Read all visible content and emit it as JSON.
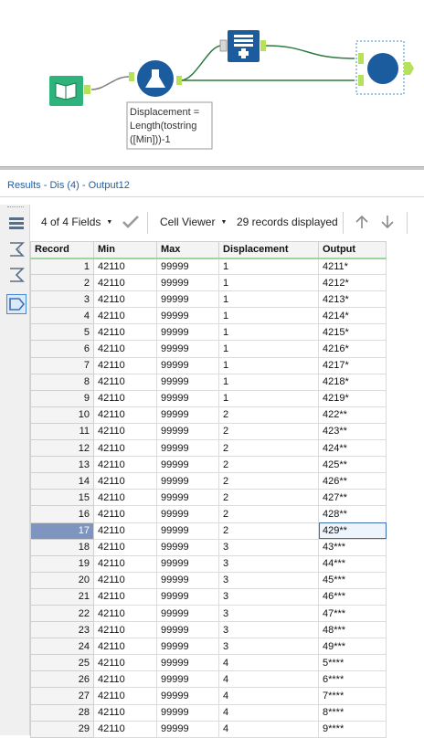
{
  "canvas": {
    "formula_annotation": [
      "Displacement =",
      "Length(tostring",
      "([Min]))-1"
    ]
  },
  "results": {
    "title": "Results - Dis (4) - Output12",
    "fields_selector": "4 of 4 Fields",
    "viewer": "Cell Viewer",
    "records_displayed": "29 records displayed",
    "selected_record": 17,
    "focused_cell": {
      "record": 17,
      "column": "Output"
    }
  },
  "table": {
    "columns": [
      "Record",
      "Min",
      "Max",
      "Displacement",
      "Output"
    ],
    "rows": [
      [
        "1",
        "42110",
        "99999",
        "1",
        "4211*"
      ],
      [
        "2",
        "42110",
        "99999",
        "1",
        "4212*"
      ],
      [
        "3",
        "42110",
        "99999",
        "1",
        "4213*"
      ],
      [
        "4",
        "42110",
        "99999",
        "1",
        "4214*"
      ],
      [
        "5",
        "42110",
        "99999",
        "1",
        "4215*"
      ],
      [
        "6",
        "42110",
        "99999",
        "1",
        "4216*"
      ],
      [
        "7",
        "42110",
        "99999",
        "1",
        "4217*"
      ],
      [
        "8",
        "42110",
        "99999",
        "1",
        "4218*"
      ],
      [
        "9",
        "42110",
        "99999",
        "1",
        "4219*"
      ],
      [
        "10",
        "42110",
        "99999",
        "2",
        "422**"
      ],
      [
        "11",
        "42110",
        "99999",
        "2",
        "423**"
      ],
      [
        "12",
        "42110",
        "99999",
        "2",
        "424**"
      ],
      [
        "13",
        "42110",
        "99999",
        "2",
        "425**"
      ],
      [
        "14",
        "42110",
        "99999",
        "2",
        "426**"
      ],
      [
        "15",
        "42110",
        "99999",
        "2",
        "427**"
      ],
      [
        "16",
        "42110",
        "99999",
        "2",
        "428**"
      ],
      [
        "17",
        "42110",
        "99999",
        "2",
        "429**"
      ],
      [
        "18",
        "42110",
        "99999",
        "3",
        "43***"
      ],
      [
        "19",
        "42110",
        "99999",
        "3",
        "44***"
      ],
      [
        "20",
        "42110",
        "99999",
        "3",
        "45***"
      ],
      [
        "21",
        "42110",
        "99999",
        "3",
        "46***"
      ],
      [
        "22",
        "42110",
        "99999",
        "3",
        "47***"
      ],
      [
        "23",
        "42110",
        "99999",
        "3",
        "48***"
      ],
      [
        "24",
        "42110",
        "99999",
        "3",
        "49***"
      ],
      [
        "25",
        "42110",
        "99999",
        "4",
        "5****"
      ],
      [
        "26",
        "42110",
        "99999",
        "4",
        "6****"
      ],
      [
        "27",
        "42110",
        "99999",
        "4",
        "7****"
      ],
      [
        "28",
        "42110",
        "99999",
        "4",
        "8****"
      ],
      [
        "29",
        "42110",
        "99999",
        "4",
        "9****"
      ]
    ]
  },
  "icons": {
    "input": "book-open-icon",
    "formula": "formula-flask-icon",
    "append": "append-fields-icon",
    "output": "output-circle-icon"
  },
  "colors": {
    "input_tool": "#2db37b",
    "formula_tool": "#1a5c9e",
    "append_tool": "#1a5c9e",
    "output_tool": "#1a5c9e",
    "connection": "#2f7a3f",
    "anchor": "#b6e25a",
    "accent": "#1f5fa5"
  }
}
